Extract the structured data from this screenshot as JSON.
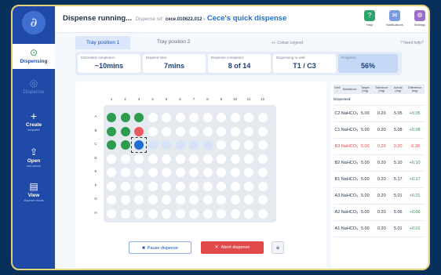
{
  "app": {
    "logo_glyph": "∂",
    "title": "Dispense running...",
    "ref_label": "Dispense ref:",
    "ref_value": "cece.010622.012 -",
    "dispense_name": "Cece's quick dispense"
  },
  "toolbar": [
    {
      "label": "Help",
      "icon": "help-icon",
      "glyph": "?",
      "color": "#2ea36a"
    },
    {
      "label": "Notifications",
      "icon": "bell-icon",
      "glyph": "✉",
      "color": "#7a9be0"
    },
    {
      "label": "Settings",
      "icon": "gear-icon",
      "glyph": "⚙",
      "color": "#9b6fc8"
    }
  ],
  "sidebar": [
    {
      "label": "Dispensing",
      "glyph": "⊙",
      "sub": ""
    },
    {
      "label": "Dispense",
      "glyph": "◎",
      "sub": ""
    },
    {
      "label": "Create",
      "glyph": "+",
      "sub": "templates"
    },
    {
      "label": "Open",
      "glyph": "⇪",
      "sub": "last actions"
    },
    {
      "label": "View",
      "glyph": "▤",
      "sub": "dispense results"
    }
  ],
  "tabs": [
    "Tray position 1",
    "Tray position 2"
  ],
  "colour_legend": "+/- Colour Legend",
  "need_help": "? Need help?",
  "stats": [
    {
      "label": "Estimated completion:",
      "value": "~10mins"
    },
    {
      "label": "Elapsed time:",
      "value": "7mins"
    },
    {
      "label": "Dispense completed:",
      "value": "8 of 14"
    },
    {
      "label": "Dispensing to well:",
      "value": "T1 / C3"
    },
    {
      "label": "Progress:",
      "value": "56%"
    }
  ],
  "plate": {
    "columns": [
      "1",
      "2",
      "3",
      "4",
      "5",
      "6",
      "7",
      "8",
      "9",
      "10",
      "11",
      "12"
    ],
    "rows": [
      "A",
      "B",
      "C",
      "D",
      "E",
      "F",
      "G",
      "H"
    ],
    "wells_status": {
      "A1": "done",
      "A2": "done",
      "A3": "done",
      "B1": "done",
      "B2": "done",
      "B3": "err",
      "C1": "done",
      "C2": "done",
      "C3": "cur",
      "C4": "q",
      "C5": "q",
      "C6": "q",
      "C7": "q",
      "C8": "q"
    }
  },
  "actions": {
    "pause_label": "Pause dispense",
    "abort_label": "Abort dispense",
    "zoom_glyph": "⊕"
  },
  "table": {
    "headers": [
      "Well ↓",
      "Substance",
      "Target (mg)",
      "Tolerance (mg)",
      "Actual (mg)",
      "Difference (mg)"
    ],
    "group_label": "Dispensed:",
    "rows": [
      {
        "well": "C2",
        "substance": "NaHCO₃",
        "target": "5.00",
        "tolerance": "0.20",
        "actual": "5.05",
        "diff": "+0.05",
        "status": "ok"
      },
      {
        "well": "C1",
        "substance": "NaHCO₃",
        "target": "5.00",
        "tolerance": "0.20",
        "actual": "5.08",
        "diff": "+0.08",
        "status": "ok"
      },
      {
        "well": "B3",
        "substance": "NaHCO₃",
        "target": "5.00",
        "tolerance": "0.20",
        "actual": "0.20",
        "diff": "-0.30",
        "status": "bad"
      },
      {
        "well": "B2",
        "substance": "NaHCO₃",
        "target": "5.00",
        "tolerance": "0.20",
        "actual": "5.10",
        "diff": "+0.10",
        "status": "ok"
      },
      {
        "well": "B1",
        "substance": "NaHCO₃",
        "target": "5.00",
        "tolerance": "0.20",
        "actual": "5.17",
        "diff": "+0.17",
        "status": "ok"
      },
      {
        "well": "A3",
        "substance": "NaHCO₃",
        "target": "5.00",
        "tolerance": "0.20",
        "actual": "5.01",
        "diff": "+0.01",
        "status": "ok"
      },
      {
        "well": "A2",
        "substance": "NaHCO₃",
        "target": "5.00",
        "tolerance": "0.20",
        "actual": "5.06",
        "diff": "+0.06",
        "status": "ok"
      },
      {
        "well": "A1",
        "substance": "NaHCO₃",
        "target": "5.00",
        "tolerance": "0.20",
        "actual": "5.01",
        "diff": "+0.01",
        "status": "ok"
      }
    ]
  },
  "colors": {
    "done": "#2e9c4f",
    "error": "#ed5a5e",
    "current": "#1f6fd0",
    "queued": "#d6e3f7",
    "sidebar": "#1f4aa8",
    "accent": "#1d6fd0"
  }
}
